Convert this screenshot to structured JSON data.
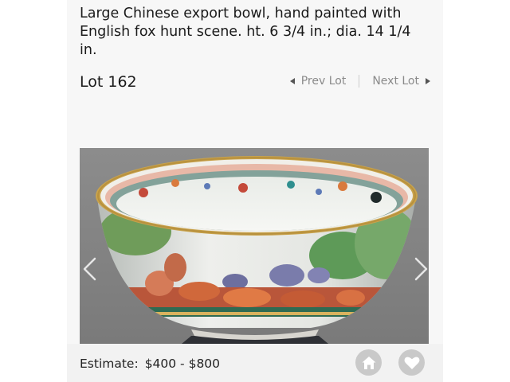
{
  "lot": {
    "title": "Large Chinese export bowl, hand painted with English fox hunt scene. ht. 6 3/4 in.; dia. 14 1/4 in.",
    "number": "Lot 162"
  },
  "navigation": {
    "prev_label": "Prev Lot",
    "next_label": "Next Lot"
  },
  "photo": {
    "subject": "porcelain bowl with fox hunt scene"
  },
  "footer": {
    "estimate_label": "Estimate:",
    "estimate_value": "$400 - $800"
  },
  "icons": {
    "prev": "caret-left-icon",
    "next": "caret-right-icon",
    "carousel_prev": "chevron-left-icon",
    "carousel_next": "chevron-right-icon",
    "home": "home-icon",
    "favorite": "heart-icon"
  },
  "colors": {
    "panel_background": "#f7f7f7",
    "footer_background": "#f2f2f2",
    "icon_button": "#c9c9c9",
    "muted_text": "#8a8a8a"
  }
}
